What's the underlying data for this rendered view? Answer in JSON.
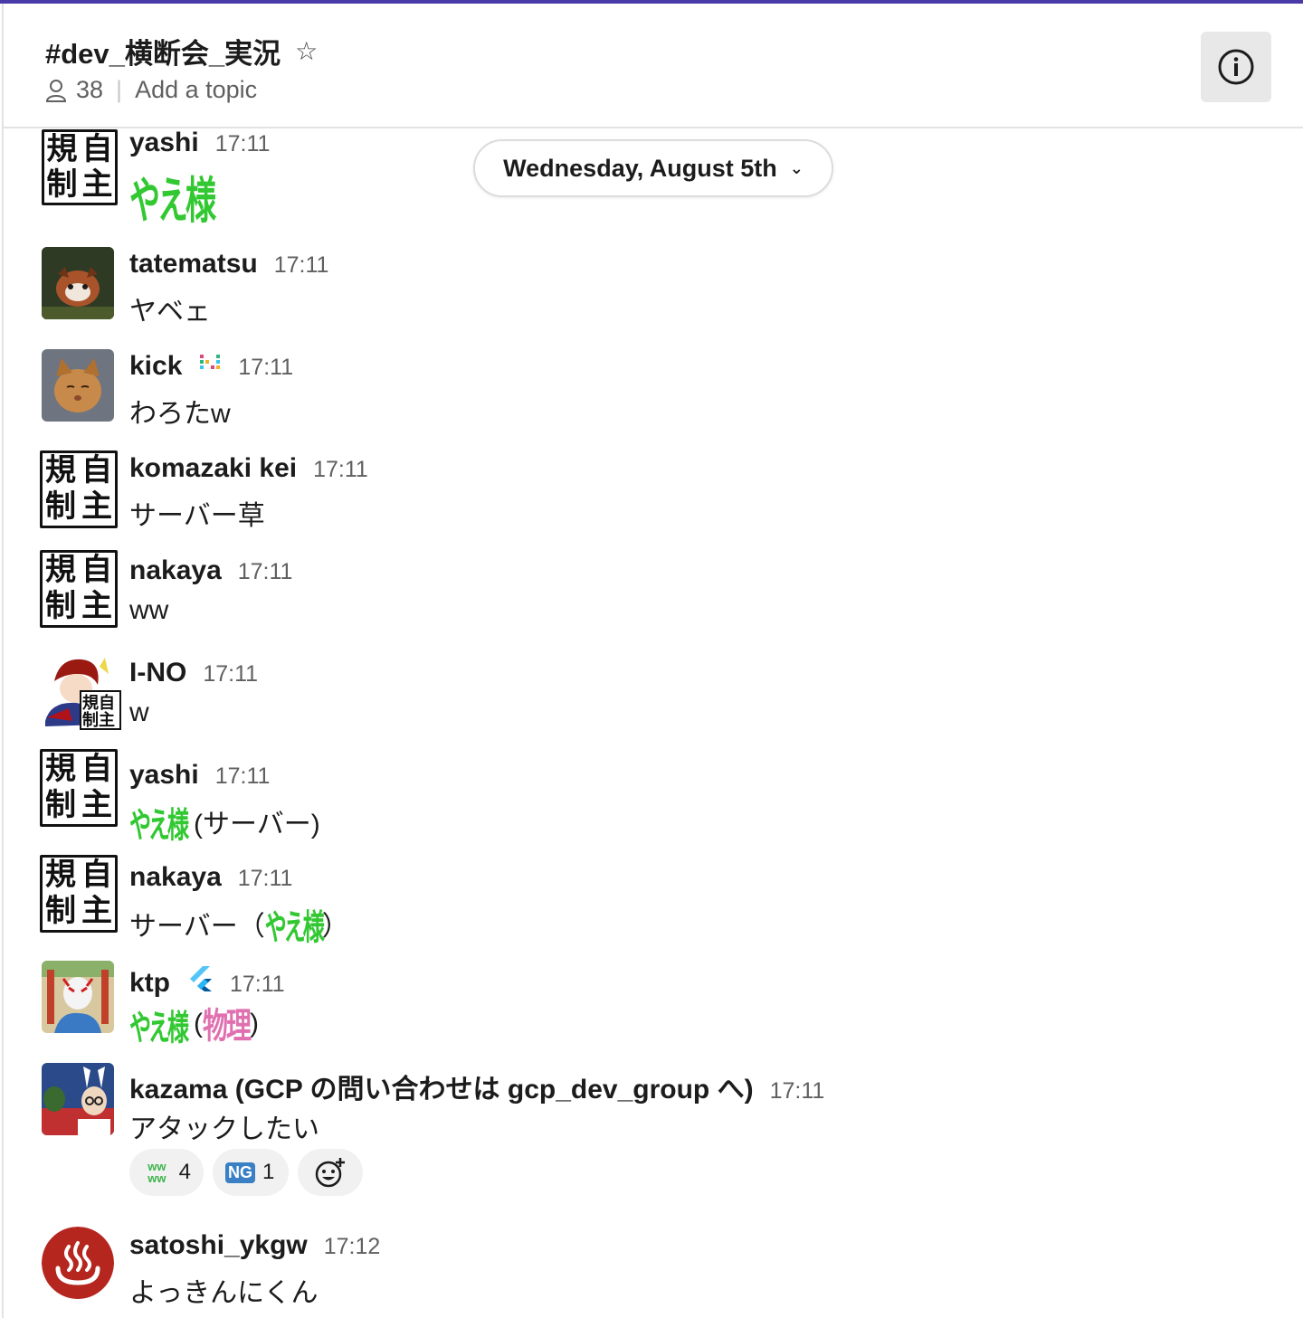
{
  "header": {
    "channel_name": "#dev_横断会_実況",
    "member_count": "38",
    "topic_placeholder": "Add a topic"
  },
  "date_divider": {
    "label": "Wednesday, August 5th"
  },
  "avatar_kanji": [
    "規",
    "自",
    "制",
    "主"
  ],
  "colors": {
    "accent_bar": "#4a3aa8",
    "yae_green": "#32c832",
    "butsuri_pink": "#e070b0"
  },
  "messages": [
    {
      "user": "yashi",
      "time": "17:11",
      "text": "",
      "emoji_text": "やえ様"
    },
    {
      "user": "tatematsu",
      "time": "17:11",
      "text": "ヤベェ"
    },
    {
      "user": "kick",
      "time": "17:11",
      "text": "わろたw"
    },
    {
      "user": "komazaki kei",
      "time": "17:11",
      "text": "サーバー草"
    },
    {
      "user": "nakaya",
      "time": "17:11",
      "text": "ww"
    },
    {
      "user": "I-NO",
      "time": "17:11",
      "text": "w"
    },
    {
      "user": "yashi",
      "time": "17:11",
      "emoji_text": "やえ様",
      "text": "(サーバー)"
    },
    {
      "user": "nakaya",
      "time": "17:11",
      "text_before": "サーバー（",
      "emoji_text": "やえ様",
      "text_after": "）"
    },
    {
      "user": "ktp",
      "time": "17:11",
      "emoji_text": "やえ様",
      "text_before": "(",
      "butsuri": "物理",
      "text_after": ")"
    },
    {
      "user": "kazama (GCP の問い合わせは gcp_dev_group へ)",
      "time": "17:11",
      "text": "アタックしたい",
      "reactions": [
        {
          "emoji": "www",
          "glyph": "ww ww",
          "count": "4"
        },
        {
          "emoji": "ng",
          "glyph": "NG",
          "count": "1"
        }
      ]
    },
    {
      "user": "satoshi_ykgw",
      "time": "17:12",
      "text": "よっきんにくん"
    }
  ]
}
